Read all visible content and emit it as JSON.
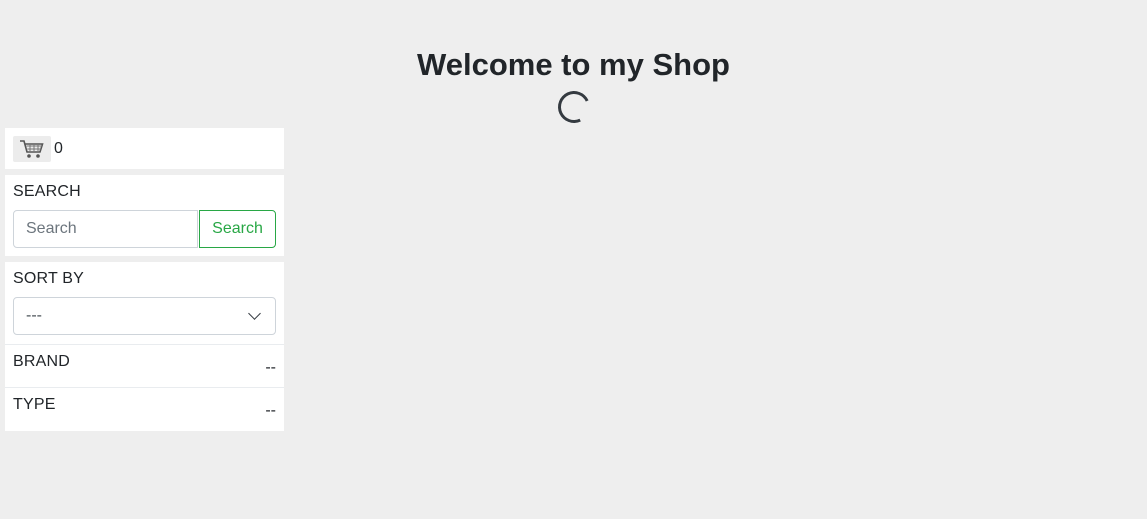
{
  "header": {
    "title": "Welcome to my Shop",
    "loading_icon": "spinner-icon"
  },
  "cart": {
    "icon": "shopping-cart-icon",
    "count": "0"
  },
  "search": {
    "label": "SEARCH",
    "placeholder": "Search",
    "value": "",
    "button_label": "Search",
    "button_color": "#28a745"
  },
  "sort": {
    "label": "SORT BY",
    "selected": "---"
  },
  "filters": {
    "brand": {
      "label": "BRAND",
      "value": "--"
    },
    "type": {
      "label": "TYPE",
      "value": "--"
    }
  },
  "colors": {
    "background": "#eeeeee",
    "panel": "#ffffff",
    "accent": "#28a745"
  }
}
